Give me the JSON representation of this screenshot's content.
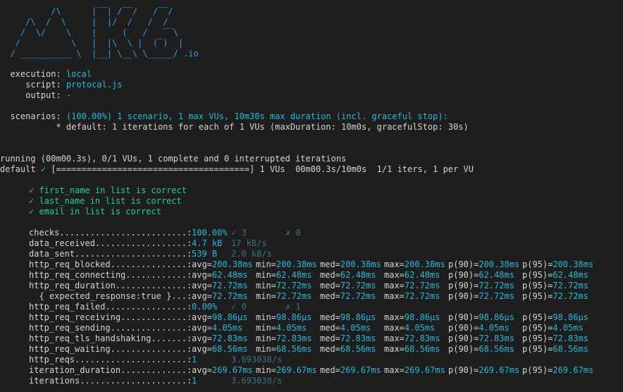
{
  "logo": {
    "lines": [
      "          /\\      |‾‾| /‾‾/   /‾‾/",
      "     /\\  /  \\     |  |/  /   /  /",
      "    /  \\/    \\    |     (   /   ‾‾\\",
      "   /          \\   |  |\\  \\ |  (‾)  |",
      "  / __________ \\  |__| \\__\\ \\_____/ .io"
    ]
  },
  "info": {
    "execution_key": "execution:",
    "execution_value": "local",
    "script_key": "script:",
    "script_value": "protocal.js",
    "output_key": "output:",
    "output_value": "-",
    "scenarios_key": "scenarios:",
    "scenarios_value": "(100.00%) 1 scenario, 1 max VUs, 10m30s max duration (incl. graceful stop):",
    "scenario_detail": "* default: 1 iterations for each of 1 VUs (maxDuration: 10m0s, gracefulStop: 30s)"
  },
  "progress": {
    "running": "running (00m00.3s), 0/1 VUs, 1 complete and 0 interrupted iterations",
    "default_label": "default",
    "check_mark": "✓",
    "bar": "[======================================]",
    "stats": "1 VUs  00m00.3s/10m0s  1/1 iters, 1 per VU",
    "fraction": 1.0
  },
  "checks_list": [
    "✓ first_name in list is correct",
    "✓ last_name in list is correct",
    "✓ email in list is correct"
  ],
  "metrics": [
    {
      "name": "checks.........................:",
      "v1": "100.00%",
      "v2": "✓ 3",
      "v3": "✗ 0"
    },
    {
      "name": "data_received..................:",
      "v1": "4.7 kB",
      "v2": "17 kB/s"
    },
    {
      "name": "data_sent......................:",
      "v1": "539 B",
      "v2": "2.0 kB/s"
    },
    {
      "name": "http_req_blocked...............:",
      "avg": "200.38ms",
      "min": "200.38ms",
      "med": "200.38ms",
      "max": "200.38ms",
      "p90": "200.38ms",
      "p95": "200.38ms"
    },
    {
      "name": "http_req_connecting............:",
      "avg": "62.48ms",
      "min": "62.48ms",
      "med": "62.48ms",
      "max": "62.48ms",
      "p90": "62.48ms",
      "p95": "62.48ms"
    },
    {
      "name": "http_req_duration..............:",
      "avg": "72.72ms",
      "min": "72.72ms",
      "med": "72.72ms",
      "max": "72.72ms",
      "p90": "72.72ms",
      "p95": "72.72ms"
    },
    {
      "name": "  { expected_response:true }...:",
      "avg": "72.72ms",
      "min": "72.72ms",
      "med": "72.72ms",
      "max": "72.72ms",
      "p90": "72.72ms",
      "p95": "72.72ms"
    },
    {
      "name": "http_req_failed................:",
      "v1": "0.00%",
      "v2": "✓ 0",
      "v3": "✗ 1"
    },
    {
      "name": "http_req_receiving.............:",
      "avg": "98.86µs",
      "min": "98.86µs",
      "med": "98.86µs",
      "max": "98.86µs",
      "p90": "98.86µs",
      "p95": "98.86µs"
    },
    {
      "name": "http_req_sending...............:",
      "avg": "4.05ms",
      "min": "4.05ms",
      "med": "4.05ms",
      "max": "4.05ms",
      "p90": "4.05ms",
      "p95": "4.05ms"
    },
    {
      "name": "http_req_tls_handshaking.......:",
      "avg": "72.83ms",
      "min": "72.83ms",
      "med": "72.83ms",
      "max": "72.83ms",
      "p90": "72.83ms",
      "p95": "72.83ms"
    },
    {
      "name": "http_req_waiting...............:",
      "avg": "68.56ms",
      "min": "68.56ms",
      "med": "68.56ms",
      "max": "68.56ms",
      "p90": "68.56ms",
      "p95": "68.56ms"
    },
    {
      "name": "http_reqs......................:",
      "v1": "1",
      "v2": "3.693038/s"
    },
    {
      "name": "iteration_duration.............:",
      "avg": "269.67ms",
      "min": "269.67ms",
      "med": "269.67ms",
      "max": "269.67ms",
      "p90": "269.67ms",
      "p95": "269.67ms"
    },
    {
      "name": "iterations.....................:",
      "v1": "1",
      "v2": "3.693038/s"
    }
  ],
  "stat_labels": {
    "avg": "avg=",
    "min": "min=",
    "med": "med=",
    "max": "max=",
    "p90": "p(90)=",
    "p95": "p(95)="
  },
  "colors": {
    "background": "#1e1e1e",
    "text": "#d4d4d4",
    "accent": "#29b8db",
    "dim": "#3f6f7f",
    "success": "#23d18b"
  }
}
